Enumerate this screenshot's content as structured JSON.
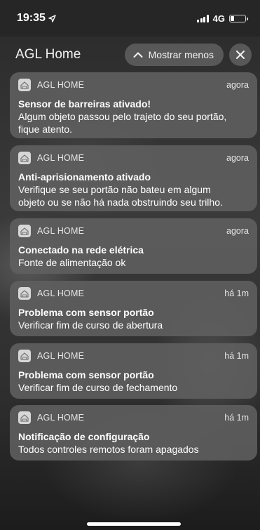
{
  "status_bar": {
    "time": "19:35",
    "network": "4G",
    "location_icon": "location-arrow-icon",
    "signal_icon": "cellular-signal-icon",
    "battery_icon": "battery-low-icon"
  },
  "header": {
    "app_title": "AGL Home",
    "show_less_label": "Mostrar menos",
    "show_less_icon": "chevron-up-icon",
    "close_icon": "close-icon"
  },
  "notifications": [
    {
      "app": "AGL HOME",
      "time": "agora",
      "title": "Sensor de barreiras ativado!",
      "body": [
        "Algum objeto passou pelo trajeto do seu portão,",
        "fique atento."
      ]
    },
    {
      "app": "AGL HOME",
      "time": "agora",
      "title": "Anti-aprisionamento ativado",
      "body": [
        "Verifique se seu portão não bateu em algum",
        "objeto ou se não há nada obstruindo seu trilho."
      ]
    },
    {
      "app": "AGL HOME",
      "time": "agora",
      "title": "Conectado na rede elétrica",
      "body": [
        "Fonte de alimentação ok"
      ]
    },
    {
      "app": "AGL HOME",
      "time": "há 1m",
      "title": "Problema com sensor portão",
      "body": [
        "Verificar fim de curso de abertura"
      ]
    },
    {
      "app": "AGL HOME",
      "time": "há 1m",
      "title": "Problema com sensor portão",
      "body": [
        "Verificar fim de curso de fechamento"
      ]
    },
    {
      "app": "AGL HOME",
      "time": "há 1m",
      "title": "Notificação de configuração",
      "body": [
        "Todos controles remotos foram apagados"
      ]
    }
  ],
  "colors": {
    "card": "#606060",
    "status_bar": "#262626",
    "pill": "#5f5f5f"
  }
}
